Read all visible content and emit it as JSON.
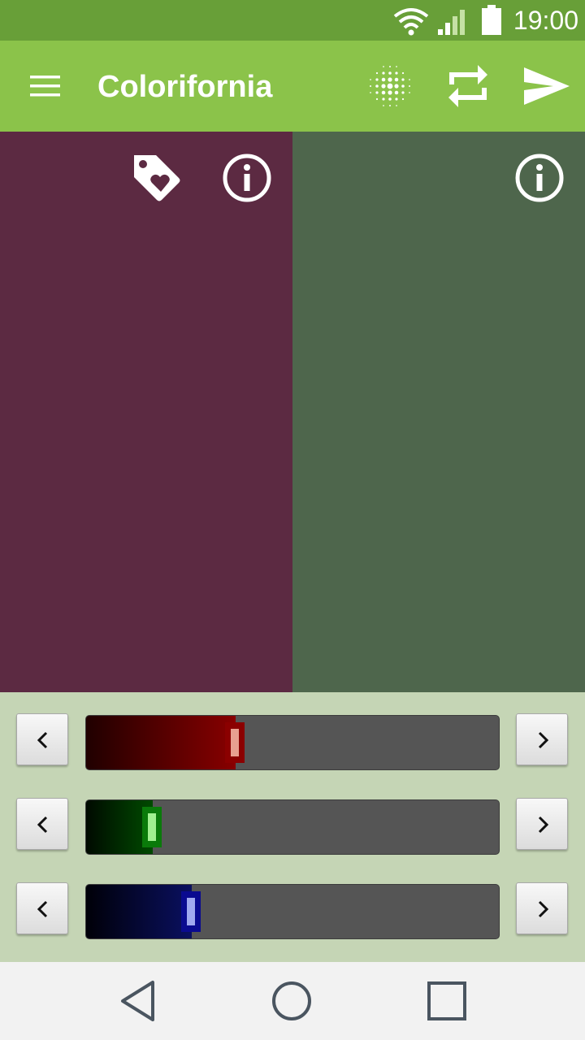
{
  "status_bar": {
    "time": "19:00",
    "icons": [
      "wifi-icon",
      "signal-icon",
      "battery-icon"
    ]
  },
  "app_bar": {
    "menu_icon": "menu-icon",
    "title": "Colorifornia",
    "actions": [
      "dots-pattern-icon",
      "swap-icon",
      "send-icon"
    ]
  },
  "panels": {
    "left": {
      "color": "#5c2a42",
      "icons": [
        "tag-heart-icon",
        "info-icon"
      ]
    },
    "right": {
      "color": "#4e664c",
      "icons": [
        "info-icon"
      ]
    }
  },
  "sliders": [
    {
      "channel": "red",
      "value": 0.36,
      "fill_start": "#200000",
      "fill_end": "#880000",
      "thumb": "#8b0000",
      "thumb_inner": "#e8a090"
    },
    {
      "channel": "green",
      "value": 0.16,
      "fill_start": "#000a00",
      "fill_end": "#004a00",
      "thumb": "#0a7a0a",
      "thumb_inner": "#a0f090"
    },
    {
      "channel": "blue",
      "value": 0.255,
      "fill_start": "#000008",
      "fill_end": "#0a1060",
      "thumb": "#0a0a90",
      "thumb_inner": "#a0a8f0"
    }
  ],
  "navigation": [
    "back-icon",
    "home-icon",
    "recents-icon"
  ],
  "colors": {
    "status_bar": "#689f38",
    "app_bar": "#8bc34a",
    "controls_background": "#c5d5b5",
    "track": "#555555",
    "nav_bar": "#f2f2f2"
  }
}
